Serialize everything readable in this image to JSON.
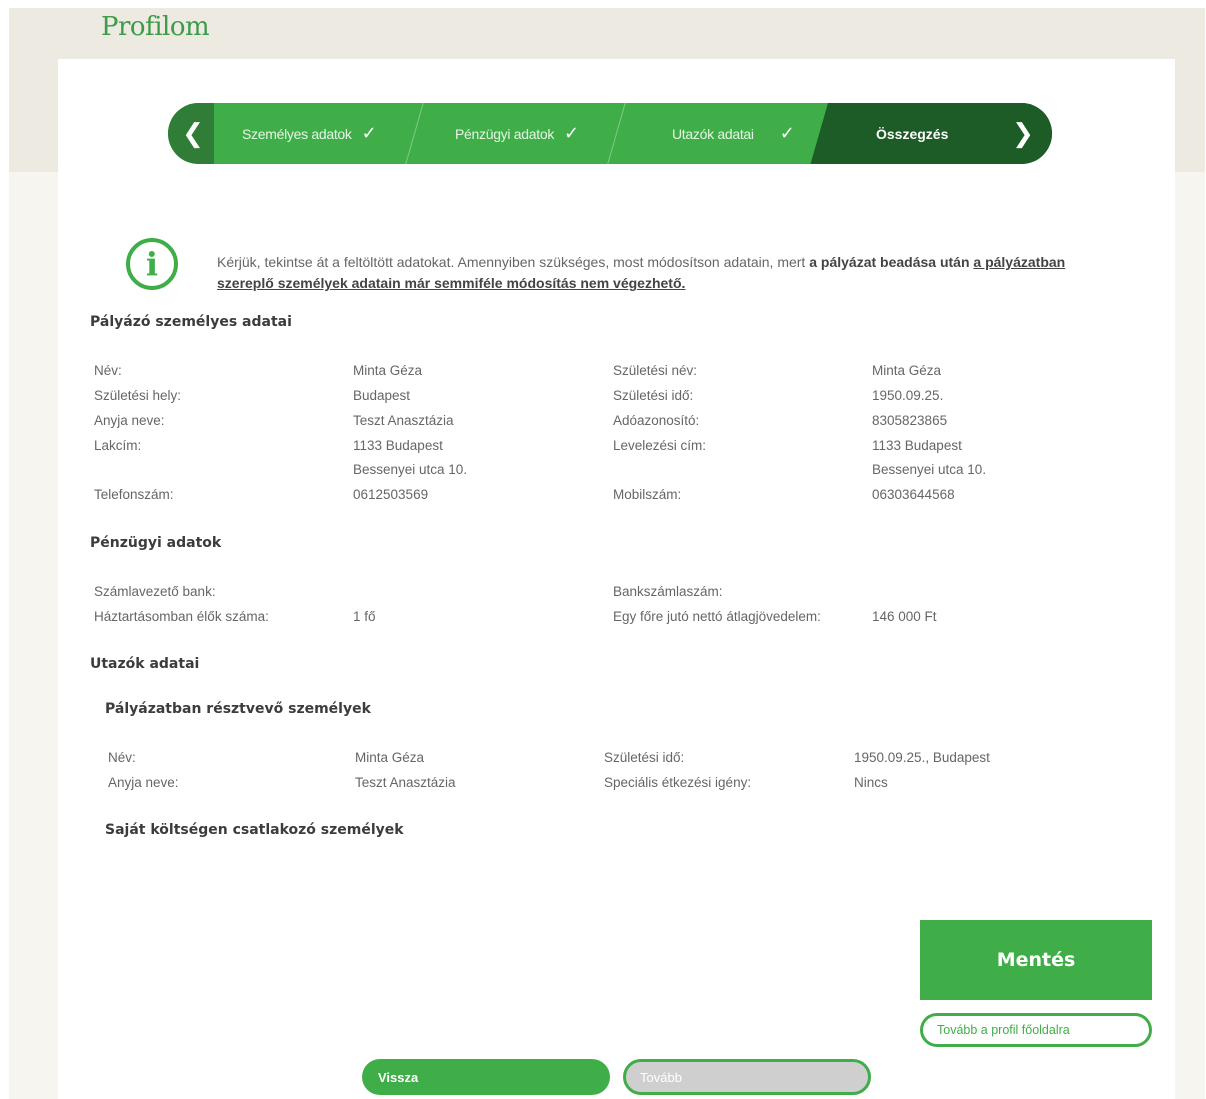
{
  "page": {
    "title": "Profilom"
  },
  "steps": [
    {
      "label": "Személyes adatok",
      "done": true
    },
    {
      "label": "Pénzügyi adatok",
      "done": true
    },
    {
      "label": "Utazók adatai",
      "done": true
    },
    {
      "label": "Összegzés",
      "done": false,
      "active": true
    }
  ],
  "steps_nav": {
    "prev_icon": "chevron-left-icon",
    "next_icon": "chevron-right-icon",
    "check_icon": "check-icon"
  },
  "notice": {
    "text_plain": "Kérjük, tekintse át a feltöltött adatokat. Amennyiben szükséges, most módosítson adatain, mert ",
    "text_bold": "a pályázat beadása után ",
    "text_bold_underline": "a pályázatban szereplő személyek adatain már semmiféle módosítás nem végezhető."
  },
  "personal": {
    "title": "Pályázó személyes adatai",
    "rows": [
      {
        "l1": "Név:",
        "v1": "Minta Géza",
        "l2": "Születési név:",
        "v2": "Minta Géza"
      },
      {
        "l1": "Születési hely:",
        "v1": "Budapest",
        "l2": "Születési idő:",
        "v2": "1950.09.25."
      },
      {
        "l1": "Anyja neve:",
        "v1": "Teszt Anasztázia",
        "l2": "Adóazonosító:",
        "v2": "8305823865"
      },
      {
        "l1": "Lakcím:",
        "v1": "1133 Budapest",
        "l2": "Levelezési cím:",
        "v2": "1133 Budapest"
      },
      {
        "l1": "",
        "v1": "Bessenyei utca 10.",
        "l2": "",
        "v2": "Bessenyei utca 10."
      },
      {
        "l1": "Telefonszám:",
        "v1": "0612503569",
        "l2": "Mobilszám:",
        "v2": "06303644568"
      }
    ]
  },
  "finance": {
    "title": "Pénzügyi adatok",
    "rows": [
      {
        "l1": "Számlavezető bank:",
        "v1": "",
        "l2": "Bankszámlaszám:",
        "v2": ""
      },
      {
        "l1": "Háztartásomban élők száma:",
        "v1": "1 fő",
        "l2": "Egy főre jutó nettó átlagjövedelem:",
        "v2": "146 000 Ft"
      }
    ]
  },
  "travelers": {
    "title": "Utazók adatai",
    "participants_title": "Pályázatban résztvevő személyek",
    "rows": [
      {
        "l1": "Név:",
        "v1": "Minta Géza",
        "l2": "Születési idő:",
        "v2": "1950.09.25., Budapest"
      },
      {
        "l1": "Anyja neve:",
        "v1": "Teszt Anasztázia",
        "l2": "Speciális étkezési igény:",
        "v2": "Nincs"
      }
    ],
    "own_cost_title": "Saját költségen csatlakozó személyek"
  },
  "buttons": {
    "save": "Mentés",
    "to_profile": "Tovább a profil főoldalra",
    "back": "Vissza",
    "next": "Tovább"
  }
}
